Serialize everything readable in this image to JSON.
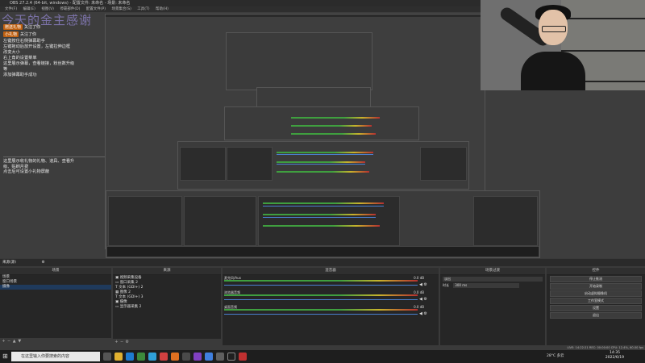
{
  "window": {
    "title": "OBS 27.2.4 (64-bit, windows) - 配置文件: 未命名 - 场景: 未命名"
  },
  "menu": [
    "文件(F)",
    "编辑(E)",
    "视图(V)",
    "停靠部件(D)",
    "配置文件(P)",
    "场景集合(S)",
    "工具(T)",
    "帮助(H)"
  ],
  "overlay": {
    "title": "今天的金主感谢",
    "alerts": [
      {
        "badge": "赠送礼物",
        "text": "关注了你"
      },
      {
        "badge": "小礼物",
        "text": "关注了你"
      }
    ],
    "instructions": [
      "左键按住右侧弹幕助手",
      "左键拖动后放开设置，左键拉伸边框",
      "改变大小",
      "右上角的设置菜单",
      "这里展示弹幕，查看链接，粉丝数升级",
      "等",
      "添加弹幕助手成功"
    ],
    "instructions2": [
      "这里展示收礼物的礼物、道具、查看升",
      "级、贴刷月费",
      "点击后可设置小礼物屏蔽"
    ]
  },
  "docks": {
    "scenes": {
      "title": "场景",
      "items": [
        "场景",
        "窗口场景",
        "摄像"
      ],
      "selected": 2
    },
    "sources": {
      "title": "来源",
      "items": [
        "视频采集设备",
        "窗口采集 2",
        "文本 (GDI+) 2",
        "图像 2",
        "文本 (GDI+) 3",
        "摄像",
        "显示器采集 2"
      ]
    },
    "mixer": {
      "title": "混音器",
      "tracks": [
        {
          "name": "麦克风/Aux",
          "db": "0.0 dB",
          "level": 0.72
        },
        {
          "name": "浏览器音频",
          "db": "0.0 dB",
          "level": 0.55
        },
        {
          "name": "桌面音频",
          "db": "0.0 dB",
          "level": 0.6
        }
      ]
    },
    "transitions": {
      "title": "场景过渡",
      "type": "淡出",
      "duration_label": "时长",
      "duration": "300 ms"
    },
    "controls": {
      "title": "控件",
      "buttons": [
        "停止推流",
        "开始录制",
        "启动虚拟摄像机",
        "工作室模式",
        "设置",
        "退出"
      ]
    }
  },
  "preview": {
    "label": "来源(源)"
  },
  "status_bar": {
    "text": "LIVE: 14:22:21   REC: 00:00:00   CPU: 12.4%, 60.00 fps"
  },
  "taskbar": {
    "search_placeholder": "在这里输入你要搜索的内容",
    "time": "14:35",
    "date": "2022/6/19",
    "temperature": "28°C 多云"
  },
  "colors": {
    "accent_alert": "#c06010",
    "overlay_title": "#7b72a8",
    "meter_green": "#3f9f3f",
    "meter_yellow": "#c8b32c",
    "meter_red": "#b53030",
    "selected": "#1f3a5c"
  }
}
